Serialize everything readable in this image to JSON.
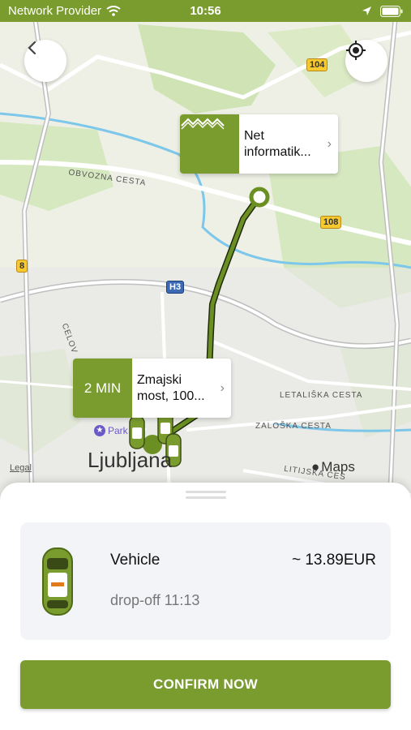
{
  "status_bar": {
    "carrier": "Network Provider",
    "time": "10:56"
  },
  "map": {
    "labels": {
      "obvozna": "OBVOZNA CESTA",
      "celovska": "CELOV",
      "letaliska": "LETALIŠKA CESTA",
      "zaloska": "ZALOŠKA CESTA",
      "litijska": "LITIJSKA CES",
      "city": "Ljubljana",
      "park": "Park",
      "legal": "Legal",
      "maps": "Maps"
    },
    "roads": {
      "r104": "104",
      "r108": "108",
      "r8": "8",
      "h3": "H3"
    }
  },
  "destination_callout": {
    "title_line1": "Net",
    "title_line2": "informatik..."
  },
  "pickup_callout": {
    "eta": "2 MIN",
    "line1": "Zmajski",
    "line2": "most, 100..."
  },
  "ride_card": {
    "vehicle_label": "Vehicle",
    "price": "~ 13.89EUR",
    "dropoff": "drop-off 11:13"
  },
  "confirm_button": {
    "label": "CONFIRM NOW"
  },
  "colors": {
    "brand_green": "#7a9c2e",
    "route_green": "#6b8f22"
  }
}
